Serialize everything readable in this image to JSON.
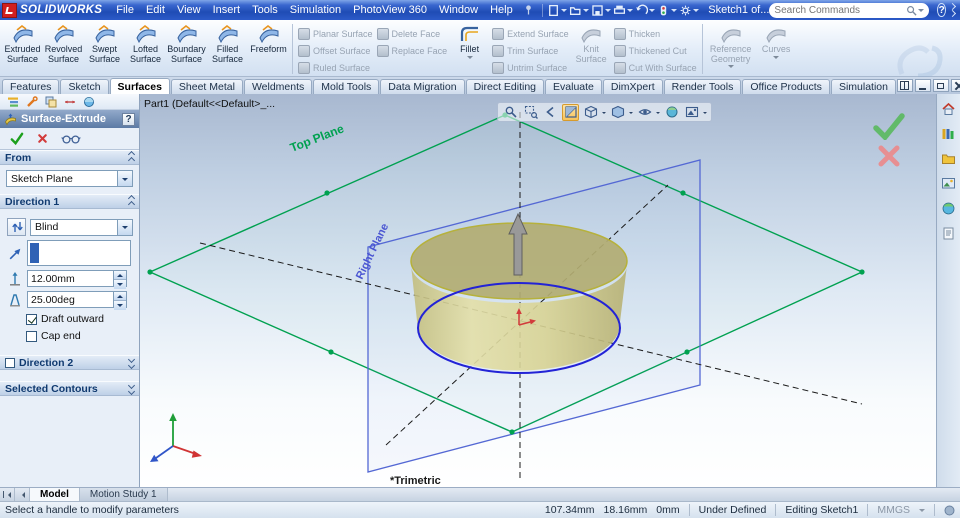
{
  "colors": {
    "titlebar_blue": "#2c5ac8",
    "plane_green": "#00a150",
    "plane_blue": "#4a55d2",
    "sketch_blue": "#2323d6",
    "preview_tan": "#d8d394",
    "disabled_gray": "#97a3b2"
  },
  "titlebar": {
    "app_name": "SOLIDWORKS",
    "doc_title": "Sketch1 of...",
    "help": "?",
    "menus": [
      "File",
      "Edit",
      "View",
      "Insert",
      "Tools",
      "Simulation",
      "PhotoView 360",
      "Window",
      "Help"
    ],
    "search_placeholder": "Search Commands"
  },
  "ribbon": {
    "extruded": "Extruded Surface",
    "revolved": "Revolved Surface",
    "swept": "Swept Surface",
    "lofted": "Lofted Surface",
    "boundary": "Boundary Surface",
    "filled": "Filled Surface",
    "freeform": "Freeform",
    "planar": "Planar Surface",
    "offset": "Offset Surface",
    "ruled": "Ruled Surface",
    "delete_face": "Delete Face",
    "replace_face": "Replace Face",
    "fillet": "Fillet",
    "extend": "Extend Surface",
    "trim": "Trim Surface",
    "untrim": "Untrim Surface",
    "knit": "Knit Surface",
    "thicken": "Thicken",
    "thickened_cut": "Thickened Cut",
    "cut_with": "Cut With Surface",
    "reference_geometry": "Reference Geometry",
    "curves": "Curves"
  },
  "tabs": {
    "items": [
      "Features",
      "Sketch",
      "Surfaces",
      "Sheet Metal",
      "Weldments",
      "Mold Tools",
      "Data Migration",
      "Direct Editing",
      "Evaluate",
      "DimXpert",
      "Render Tools",
      "Office Products",
      "Simulation"
    ],
    "active": "Surfaces"
  },
  "panel": {
    "title": "Surface-Extrude",
    "help": "?",
    "from_label": "From",
    "from_value": "Sketch Plane",
    "dir1_label": "Direction 1",
    "end_condition": "Blind",
    "depth": "12.00mm",
    "draft": "25.00deg",
    "draft_outward": "Draft outward",
    "cap_end": "Cap end",
    "dir2_label": "Direction 2",
    "contours_label": "Selected Contours"
  },
  "viewport": {
    "breadcrumb": "Part1 (Default<<Default>_...",
    "top_plane": "Top Plane",
    "right_plane": "Right Plane",
    "view_name": "*Trimetric"
  },
  "bottom_tabs": {
    "model": "Model",
    "motion_study": "Motion Study 1"
  },
  "statusbar": {
    "message": "Select a handle to modify parameters",
    "coord_x": "107.34mm",
    "coord_y": "18.16mm",
    "coord_z": "0mm",
    "constraint_state": "Under Defined",
    "edit_state": "Editing Sketch1",
    "units": "MMGS"
  }
}
